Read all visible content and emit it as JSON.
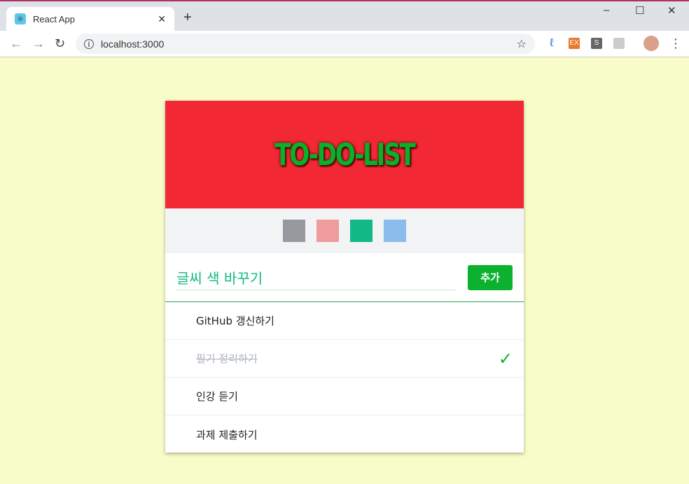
{
  "browser": {
    "tab_title": "React App",
    "url": "localhost:3000"
  },
  "app": {
    "title": "TO-DO-LIST",
    "colors": [
      "#969a9f",
      "#f09c9c",
      "#12b886",
      "#8cbcec"
    ],
    "input_value": "글씨 색 바꾸기",
    "add_label": "추가",
    "todos": [
      {
        "text": "GitHub 갱신하기",
        "done": false
      },
      {
        "text": "필기 정리하기",
        "done": true
      },
      {
        "text": "인강 듣기",
        "done": false
      },
      {
        "text": "과제 제출하기",
        "done": false
      }
    ],
    "check_mark": "✓"
  }
}
